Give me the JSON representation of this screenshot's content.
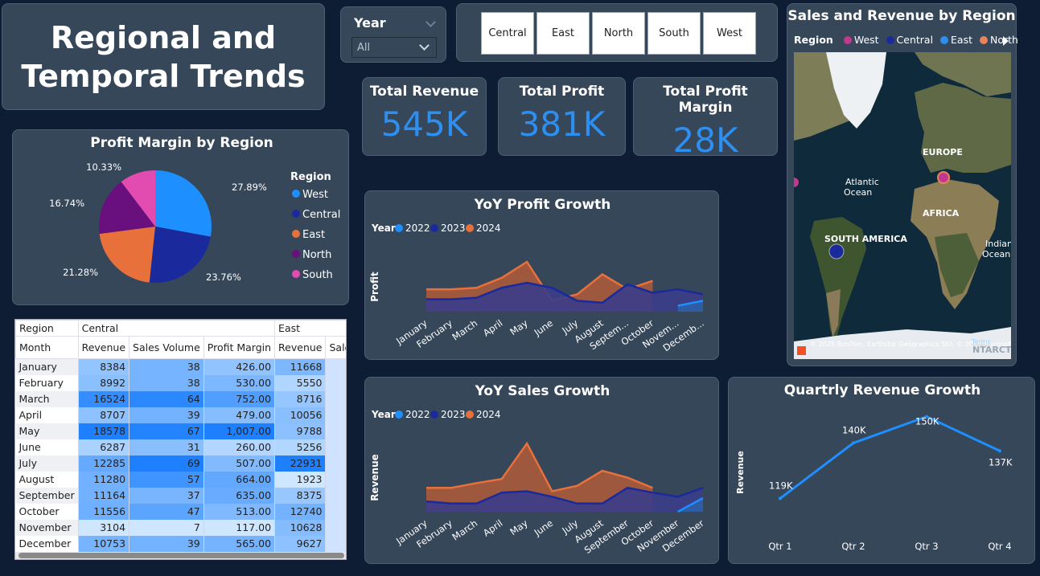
{
  "title": "Regional and Temporal Trends",
  "year_filter": {
    "label": "Year",
    "value": "All"
  },
  "region_buttons": [
    "Central",
    "East",
    "North",
    "South",
    "West"
  ],
  "kpis": [
    {
      "label": "Total Revenue",
      "value": "545K"
    },
    {
      "label": "Total Profit",
      "value": "381K"
    },
    {
      "label": "Total Profit Margin",
      "value": "28K"
    }
  ],
  "map": {
    "title": "Sales and Revenue by Region",
    "legend_title": "Region",
    "legend": [
      {
        "name": "West",
        "color": "#c0398e"
      },
      {
        "name": "Central",
        "color": "#1a2a9c"
      },
      {
        "name": "East",
        "color": "#2d8ff0"
      },
      {
        "name": "North",
        "color": "#e8835a"
      }
    ],
    "labels": [
      "EUROPE",
      "Atlantic Ocean",
      "AFRICA",
      "SOUTH AMERICA",
      "Indian Ocean"
    ],
    "attribution": "© 2025 TomTom, Earthstar Geographics SIO, © 2025 Microsoft Corporation, © OpenStreetMap",
    "terms": "Terms",
    "corner_label": "NTARCTICA"
  },
  "pie": {
    "title": "Profit Margin by Region",
    "legend_title": "Region",
    "slices": [
      {
        "name": "West",
        "value": 27.89,
        "label": "27.89%",
        "color": "#1e8fff"
      },
      {
        "name": "Central",
        "value": 23.76,
        "label": "23.76%",
        "color": "#1a2a9c"
      },
      {
        "name": "East",
        "value": 21.28,
        "label": "21.28%",
        "color": "#e8703a"
      },
      {
        "name": "North",
        "value": 16.74,
        "label": "16.74%",
        "color": "#6a0f7e"
      },
      {
        "name": "South",
        "value": 10.33,
        "label": "10.33%",
        "color": "#e24cb0"
      }
    ]
  },
  "table": {
    "group_header": "Region",
    "row_header": "Month",
    "groups": [
      {
        "name": "Central",
        "columns": [
          "Revenue",
          "Sales Volume",
          "Profit Margin"
        ]
      },
      {
        "name": "East",
        "columns": [
          "Revenue",
          "Sales Volume"
        ]
      }
    ],
    "rows": [
      {
        "month": "January",
        "central_revenue": "8384",
        "central_sales_volume": "38",
        "central_profit_margin": "426.00",
        "east_revenue": "11668"
      },
      {
        "month": "February",
        "central_revenue": "8992",
        "central_sales_volume": "38",
        "central_profit_margin": "530.00",
        "east_revenue": "5550"
      },
      {
        "month": "March",
        "central_revenue": "16524",
        "central_sales_volume": "64",
        "central_profit_margin": "752.00",
        "east_revenue": "8716"
      },
      {
        "month": "April",
        "central_revenue": "8707",
        "central_sales_volume": "39",
        "central_profit_margin": "479.00",
        "east_revenue": "10056"
      },
      {
        "month": "May",
        "central_revenue": "18578",
        "central_sales_volume": "67",
        "central_profit_margin": "1,007.00",
        "east_revenue": "9788"
      },
      {
        "month": "June",
        "central_revenue": "6287",
        "central_sales_volume": "31",
        "central_profit_margin": "260.00",
        "east_revenue": "5256"
      },
      {
        "month": "July",
        "central_revenue": "12285",
        "central_sales_volume": "69",
        "central_profit_margin": "507.00",
        "east_revenue": "22931"
      },
      {
        "month": "August",
        "central_revenue": "11280",
        "central_sales_volume": "57",
        "central_profit_margin": "664.00",
        "east_revenue": "1923"
      },
      {
        "month": "September",
        "central_revenue": "11164",
        "central_sales_volume": "37",
        "central_profit_margin": "635.00",
        "east_revenue": "8375"
      },
      {
        "month": "October",
        "central_revenue": "11556",
        "central_sales_volume": "47",
        "central_profit_margin": "513.00",
        "east_revenue": "12740"
      },
      {
        "month": "November",
        "central_revenue": "3104",
        "central_sales_volume": "7",
        "central_profit_margin": "117.00",
        "east_revenue": "10628"
      },
      {
        "month": "December",
        "central_revenue": "10753",
        "central_sales_volume": "39",
        "central_profit_margin": "565.00",
        "east_revenue": "9627"
      }
    ]
  },
  "chart_data": [
    {
      "type": "pie",
      "title": "Profit Margin by Region",
      "categories": [
        "West",
        "Central",
        "East",
        "North",
        "South"
      ],
      "values": [
        27.89,
        23.76,
        21.28,
        16.74,
        10.33
      ]
    },
    {
      "type": "area",
      "title": "YoY Profit Growth",
      "ylabel": "Profit",
      "legend_title": "Year",
      "categories": [
        "January",
        "February",
        "March",
        "April",
        "May",
        "June",
        "July",
        "August",
        "Septem...",
        "October",
        "Novem...",
        "Decemb..."
      ],
      "ylim": [
        0,
        100
      ],
      "series": [
        {
          "name": "2022",
          "color": "#1e8fff",
          "values": [
            null,
            null,
            null,
            null,
            null,
            null,
            null,
            null,
            null,
            null,
            12,
            22
          ]
        },
        {
          "name": "2023",
          "color": "#1a2a9c",
          "values": [
            25,
            25,
            28,
            48,
            58,
            48,
            22,
            18,
            55,
            38,
            45,
            35
          ]
        },
        {
          "name": "2024",
          "color": "#e8703a",
          "values": [
            45,
            45,
            48,
            68,
            100,
            22,
            35,
            75,
            45,
            62,
            null,
            null
          ]
        }
      ]
    },
    {
      "type": "area",
      "title": "YoY Sales Growth",
      "ylabel": "Revenue",
      "legend_title": "Year",
      "categories": [
        "January",
        "February",
        "March",
        "April",
        "May",
        "June",
        "July",
        "August",
        "September",
        "October",
        "November",
        "December"
      ],
      "ylim": [
        0,
        100
      ],
      "series": [
        {
          "name": "2022",
          "color": "#1e8fff",
          "values": [
            null,
            null,
            null,
            null,
            null,
            null,
            null,
            null,
            null,
            null,
            0,
            20
          ]
        },
        {
          "name": "2023",
          "color": "#1a2a9c",
          "values": [
            15,
            12,
            12,
            28,
            30,
            22,
            12,
            12,
            35,
            28,
            22,
            35
          ]
        },
        {
          "name": "2024",
          "color": "#e8703a",
          "values": [
            35,
            35,
            42,
            48,
            100,
            30,
            38,
            60,
            50,
            35,
            null,
            null
          ]
        }
      ]
    },
    {
      "type": "line",
      "title": "Quartrly Revenue Growth",
      "ylabel": "Revenue",
      "categories": [
        "Qtr 1",
        "Qtr 2",
        "Qtr 3",
        "Qtr 4"
      ],
      "values": [
        119,
        140,
        150,
        137
      ],
      "data_labels": [
        "119K",
        "140K",
        "150K",
        "137K"
      ],
      "ylim": [
        110,
        152
      ]
    }
  ]
}
